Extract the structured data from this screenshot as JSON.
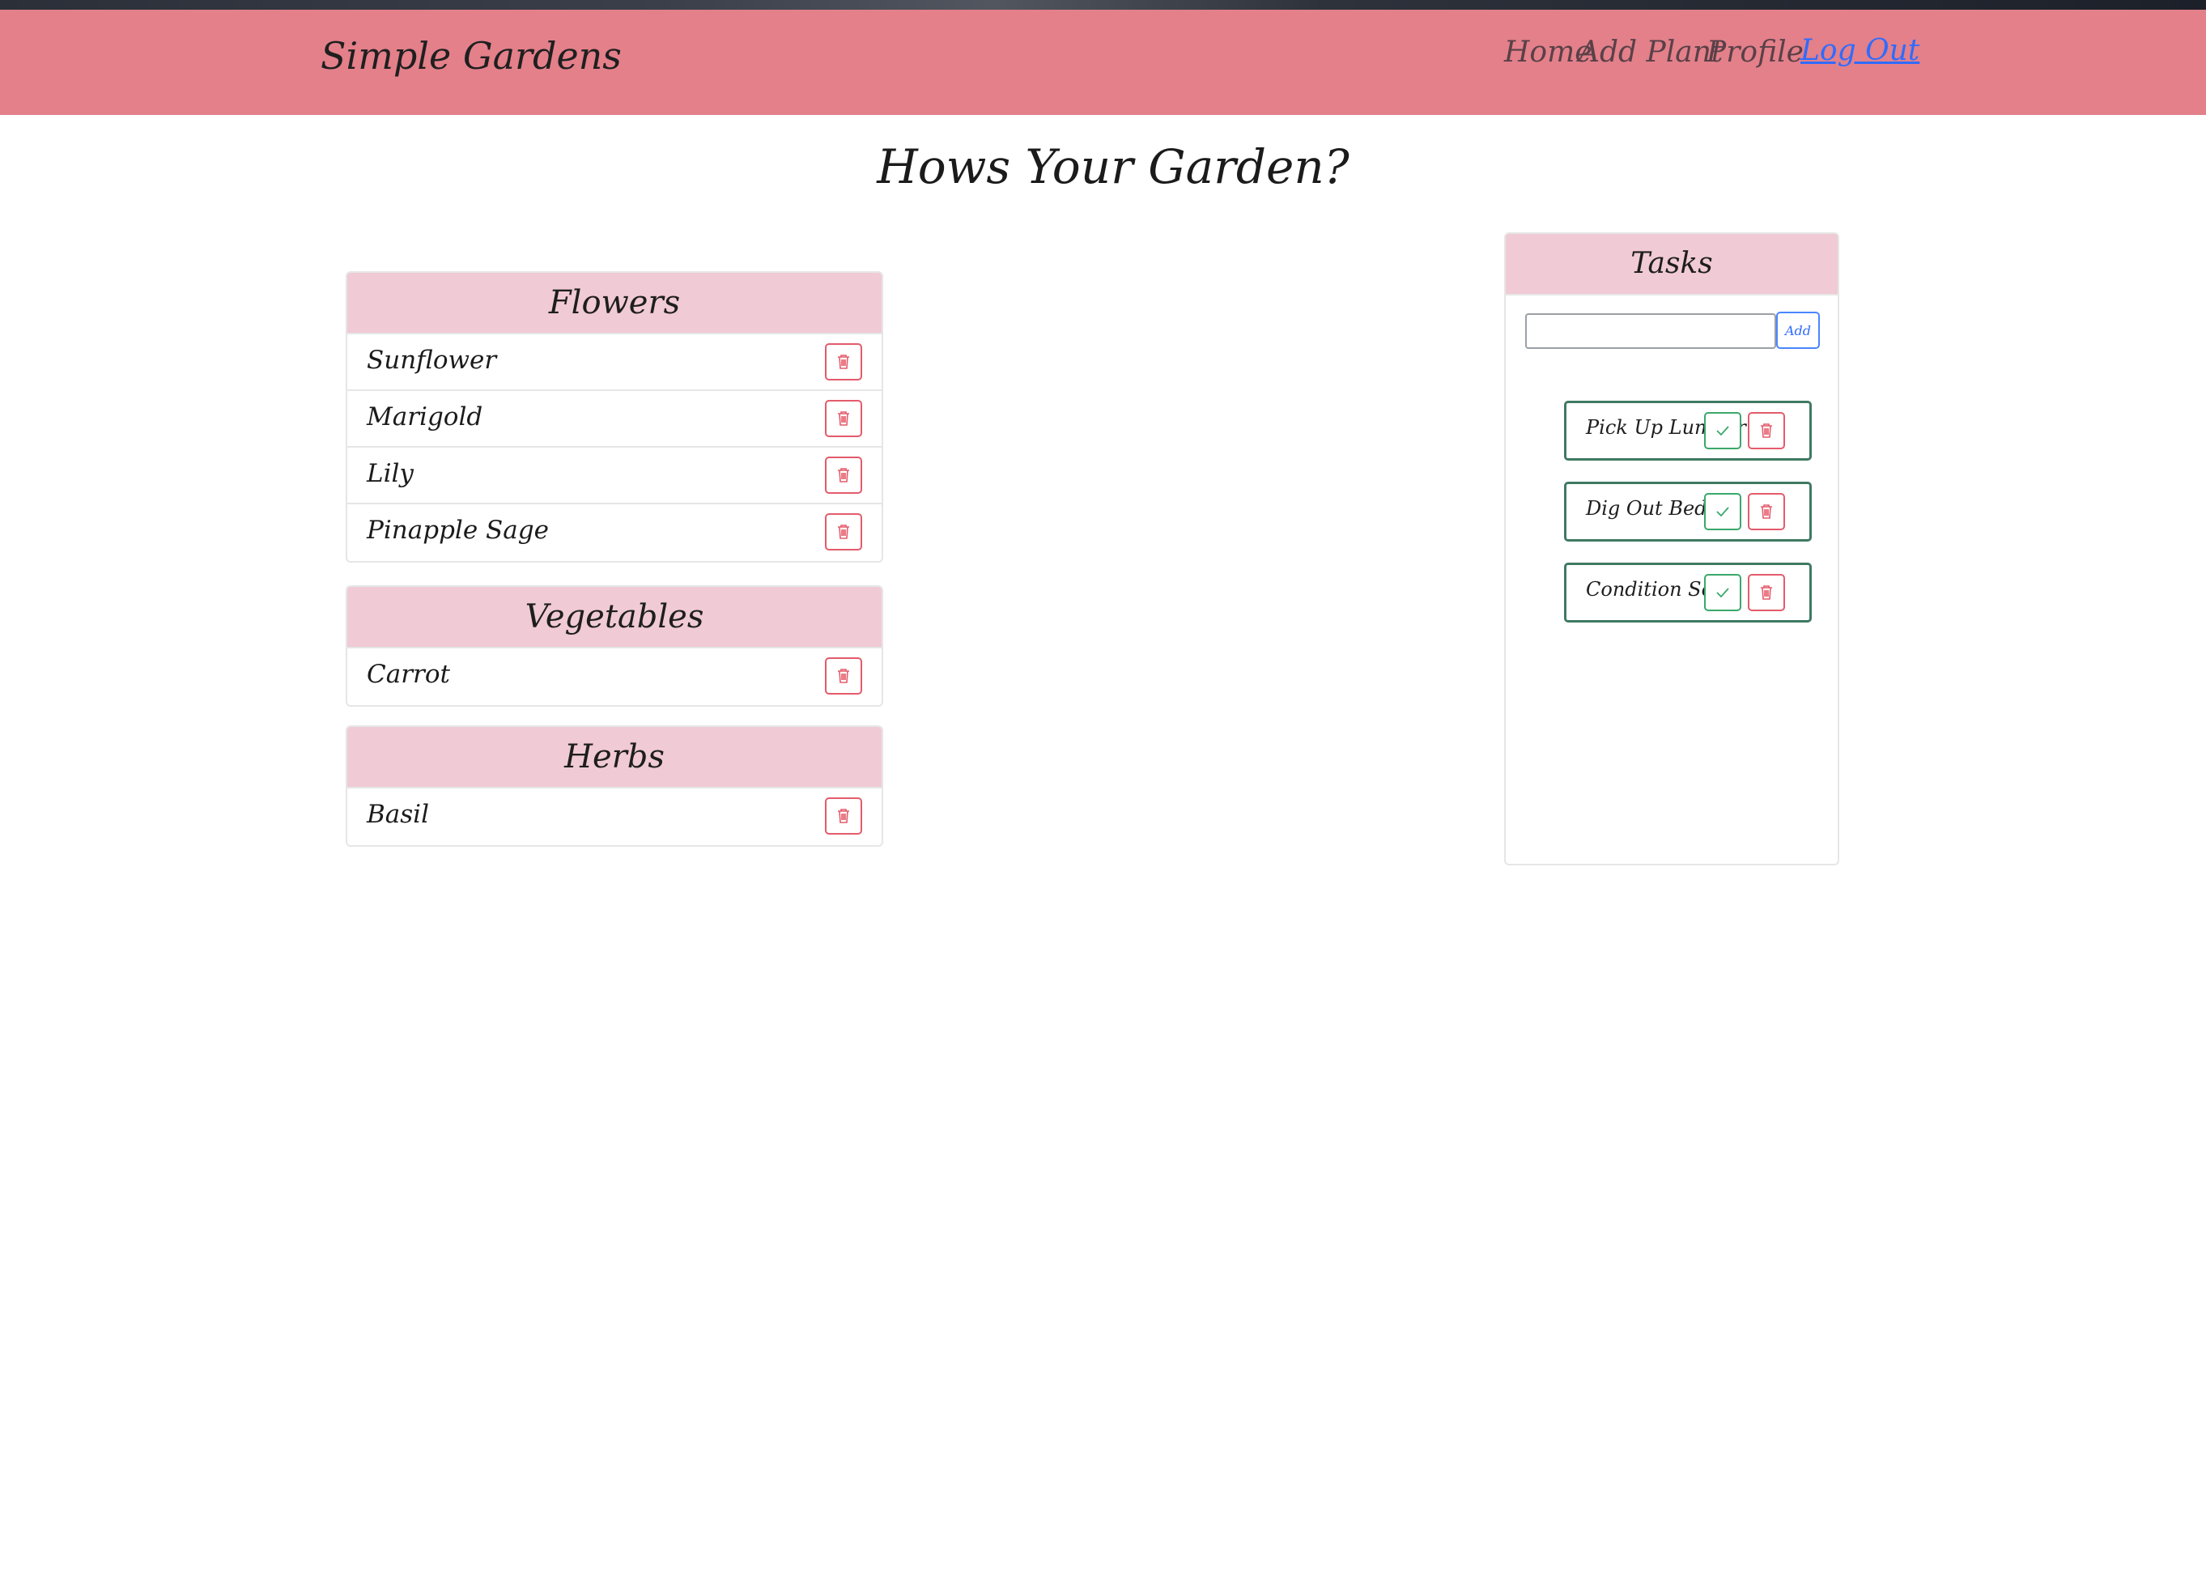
{
  "navbar": {
    "brand": "Simple Gardens",
    "links": {
      "home": "Home",
      "add_plant": "Add Plant",
      "profile": "Profile",
      "log_out": "Log Out"
    }
  },
  "page_title": "Hows Your Garden?",
  "categories": [
    {
      "title": "Flowers",
      "plants": [
        "Sunflower",
        "Marigold",
        "Lily",
        "Pinapple Sage"
      ]
    },
    {
      "title": "Vegetables",
      "plants": [
        "Carrot"
      ]
    },
    {
      "title": "Herbs",
      "plants": [
        "Basil"
      ]
    }
  ],
  "tasks": {
    "title": "Tasks",
    "input_value": "",
    "add_label": "Add",
    "items": [
      "Pick Up Lumber",
      "Dig Out Bed",
      "Condition Soil"
    ]
  },
  "colors": {
    "navbar_bg": "#e3808a",
    "card_header_bg": "#f0cad5",
    "delete_accent": "#e45b6b",
    "complete_accent": "#3aa86a",
    "task_border": "#3f7a62",
    "link_blue": "#2f6bff"
  },
  "icons": {
    "delete": "trash-icon",
    "complete": "check-icon"
  }
}
